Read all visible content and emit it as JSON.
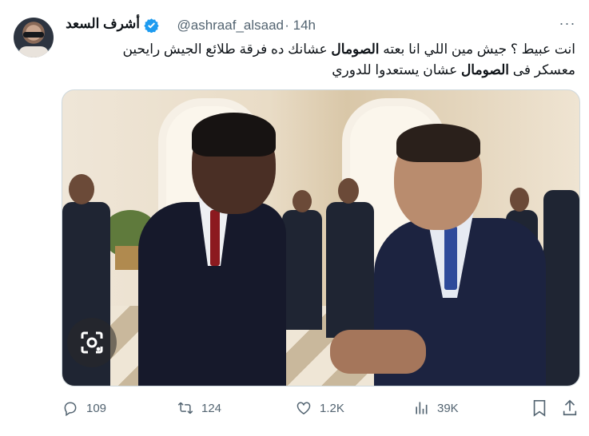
{
  "author": {
    "name": "أشرف السعد",
    "handle": "@ashraaf_alsaad",
    "time": "· 14h",
    "verified": true
  },
  "tweet": {
    "line1_a": "انت عبيط ؟ جيش مين اللي انا بعته ",
    "line1_kw": "الصومال",
    "line1_b": " عشانك ده فرقة طلائع الجيش رايحين",
    "line2_a": "معسكر فى ",
    "line2_kw": "الصومال",
    "line2_b": " عشان يستعدوا للدوري"
  },
  "more_label": "···",
  "stats": {
    "replies": "109",
    "retweets": "124",
    "likes": "1.2K",
    "views": "39K"
  },
  "icons": {
    "verified": "verified-badge-icon",
    "reply": "reply-icon",
    "retweet": "retweet-icon",
    "like": "heart-icon",
    "views": "views-chart-icon",
    "bookmark": "bookmark-icon",
    "share": "share-icon",
    "lens": "google-lens-icon"
  },
  "colors": {
    "verified": "#1d9bf0",
    "muted": "#536471",
    "text": "#0f1419"
  }
}
